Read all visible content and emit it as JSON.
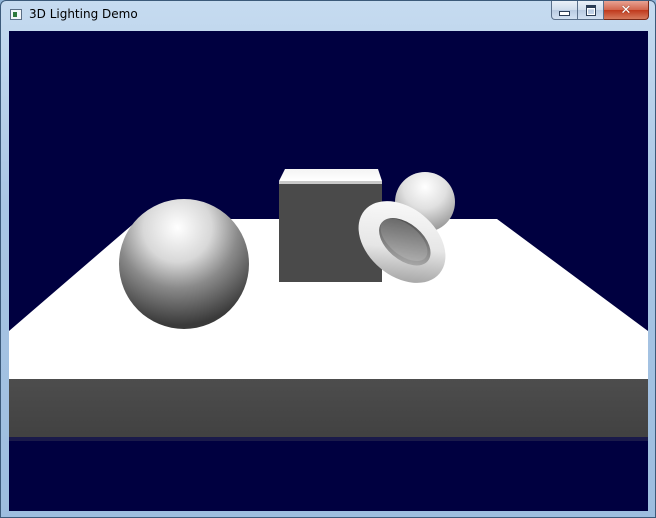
{
  "window": {
    "title": "3D Lighting Demo",
    "icon": "app-window-icon"
  },
  "caption_buttons": {
    "minimize_icon": "minimize-icon",
    "maximize_icon": "maximize-icon",
    "close_icon": "close-icon",
    "close_glyph": "✕"
  },
  "scene": {
    "background_color": "#000040",
    "objects": [
      "table",
      "sphere",
      "cube",
      "torus",
      "small-sphere"
    ]
  }
}
